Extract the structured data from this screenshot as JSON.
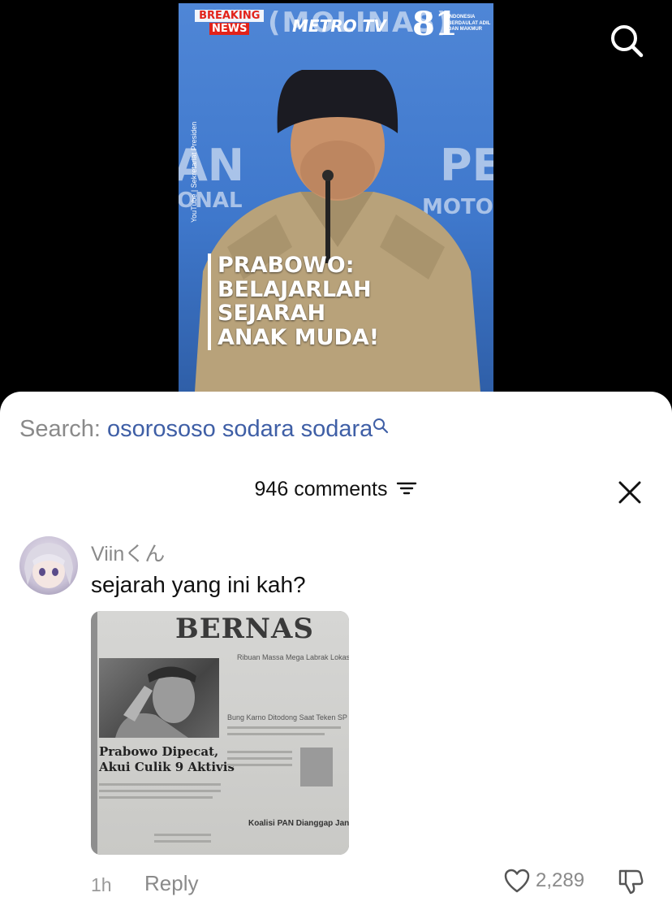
{
  "video": {
    "breaking_line1": "BREAKING",
    "breaking_line2": "NEWS",
    "channel_logo": "METRO TV",
    "anniversary_number": "81",
    "anniversary_tagline": "INDONESIA BERDAULAT ADIL DAN MAKMUR",
    "credit": "YouTube | Sekretariat Presiden",
    "headline_lines": [
      "PRABOWO:",
      "BELAJARLAH",
      "SEJARAH",
      "ANAK MUDA!"
    ],
    "search_icon": "search-icon"
  },
  "search": {
    "prefix": "Search:",
    "query": "osorososo sodara sodara"
  },
  "comments": {
    "count_label": "946 comments",
    "filter_icon": "filter-icon",
    "close_icon": "close-icon"
  },
  "comment": {
    "username": "Viinくん",
    "text": "sejarah yang ini kah?",
    "image": {
      "masthead": "BERNAS",
      "subhead1": "Ribuan Massa Mega Labrak Lokasi",
      "subhead2": "Bung Karno Ditodong Saat Teken SP",
      "headline_line1": "Prabowo Dipecat,",
      "headline_line2": "Akui Culik 9 Aktivis",
      "bottom_head": "Koalisi PAN Dianggap Janggal"
    },
    "time": "1h",
    "reply_label": "Reply",
    "likes": "2,289",
    "like_icon": "heart-icon",
    "dislike_icon": "thumbs-down-icon"
  }
}
